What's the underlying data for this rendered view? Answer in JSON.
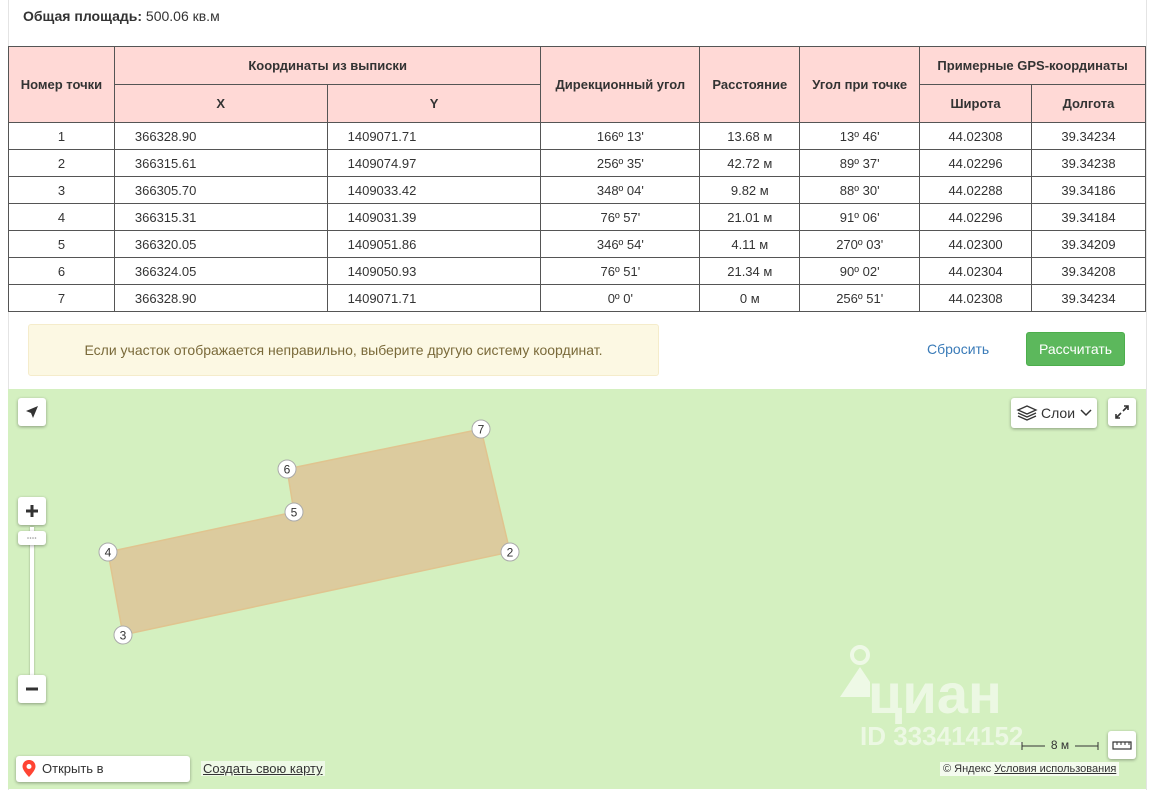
{
  "summary": {
    "area_label": "Общая площадь:",
    "area_value": "500.06 кв.м"
  },
  "table": {
    "headers": {
      "point": "Номер точки",
      "coords_group": "Координаты из выписки",
      "x": "X",
      "y": "Y",
      "bearing": "Дирекционный угол",
      "distance": "Расстояние",
      "angle": "Угол при точке",
      "gps_group": "Примерные GPS-координаты",
      "lat": "Широта",
      "lon": "Долгота"
    },
    "rows": [
      [
        "1",
        "366328.90",
        "1409071.71",
        "166º 13'",
        "13.68 м",
        "13º 46'",
        "44.02308",
        "39.34234"
      ],
      [
        "2",
        "366315.61",
        "1409074.97",
        "256º 35'",
        "42.72 м",
        "89º 37'",
        "44.02296",
        "39.34238"
      ],
      [
        "3",
        "366305.70",
        "1409033.42",
        "348º 04'",
        "9.82 м",
        "88º 30'",
        "44.02288",
        "39.34186"
      ],
      [
        "4",
        "366315.31",
        "1409031.39",
        "76º 57'",
        "21.01 м",
        "91º 06'",
        "44.02296",
        "39.34184"
      ],
      [
        "5",
        "366320.05",
        "1409051.86",
        "346º 54'",
        "4.11 м",
        "270º 03'",
        "44.02300",
        "39.34209"
      ],
      [
        "6",
        "366324.05",
        "1409050.93",
        "76º 51'",
        "21.34 м",
        "90º 02'",
        "44.02304",
        "39.34208"
      ],
      [
        "7",
        "366328.90",
        "1409071.71",
        "0º 0'",
        "0 м",
        "256º 51'",
        "44.02308",
        "39.34234"
      ]
    ]
  },
  "notice": {
    "text": "Если участок отображается неправильно, выберите другую систему координат."
  },
  "actions": {
    "reset_label": "Сбросить",
    "calculate_label": "Рассчитать"
  },
  "map": {
    "layers_label": "Слои",
    "scale_label": "8 м",
    "open_yandex_label": "Открыть в Яндекс.Картах",
    "create_map_label": "Создать свою карту",
    "copyright": "© Яндекс",
    "terms_label": "Условия использования",
    "watermark_name": "циан",
    "watermark_id": "ID 333414152",
    "point_labels": [
      "7",
      "6",
      "5",
      "4",
      "3",
      "2"
    ],
    "colors": {
      "background": "#d4f0c0",
      "parcel_fill": "#dccb9e",
      "parcel_stroke": "#e0c48f"
    }
  },
  "colors": {
    "header_bg": "#ffd9d6",
    "primary_button": "#5cb85c",
    "notice_bg": "#fcf8e3",
    "link": "#3a7bb8"
  }
}
